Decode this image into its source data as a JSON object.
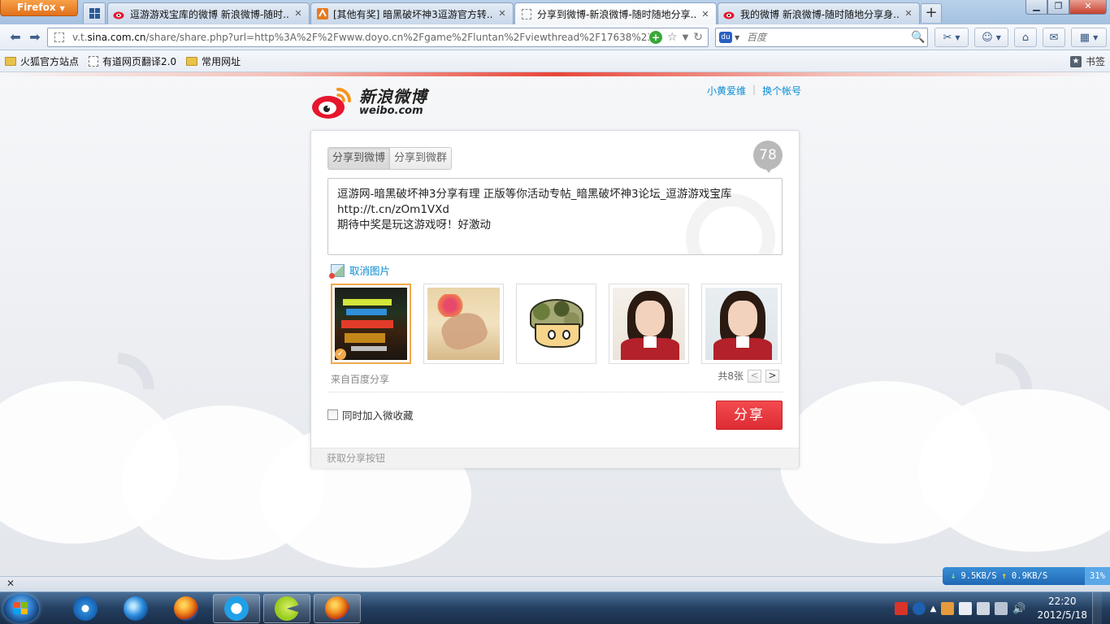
{
  "browser": {
    "app_button": "Firefox",
    "tabs": [
      {
        "title": "逗游游戏宝库的微博 新浪微博-随时...",
        "active": false
      },
      {
        "title": "[其他有奖] 暗黑破坏神3逗游官方转...",
        "active": false
      },
      {
        "title": "分享到微博-新浪微博-随时随地分享...",
        "active": true
      },
      {
        "title": "我的微博 新浪微博-随时随地分享身...",
        "active": false
      }
    ],
    "url_prefix": "v.t.",
    "url_domain": "sina.com.cn",
    "url_rest": "/share/share.php?url=http%3A%2F%2Fwww.doyo.cn%2Fgame%2Fluntan%2Fviewthread%2F17638%234529",
    "search_placeholder": "百度",
    "bookmarks": [
      "火狐官方站点",
      "有道网页翻译2.0",
      "常用网址"
    ],
    "bookmarks_menu": "书签"
  },
  "weibo": {
    "logo_cn": "新浪微博",
    "logo_en": "weibo.com",
    "user_name": "小黄爱维",
    "switch_account": "换个帐号",
    "tabs": [
      "分享到微博",
      "分享到微群"
    ],
    "char_count": "78",
    "text_lines": [
      "逗游网-暗黑破坏神3分享有理 正版等你活动专帖_暗黑破坏神3论坛_逗游游戏宝库",
      "http://t.cn/zOm1VXd",
      "期待中奖是玩这游戏呀！好激动"
    ],
    "cancel_picture": "取消图片",
    "source": "来自百度分享",
    "total_images": "共8张",
    "pager_prev": "<",
    "pager_next": ">",
    "add_favorite": "同时加入微收藏",
    "share_button": "分享",
    "get_button": "获取分享按钮"
  },
  "status": {
    "down_speed": "9.5KB/S",
    "up_speed": "0.9KB/S",
    "percent": "31%"
  },
  "taskbar": {
    "time": "22:20",
    "date": "2012/5/18"
  },
  "colors": {
    "accent_blue": "#0a8cd2",
    "share_red": "#e8363c",
    "selected_border": "#f0a84a"
  }
}
